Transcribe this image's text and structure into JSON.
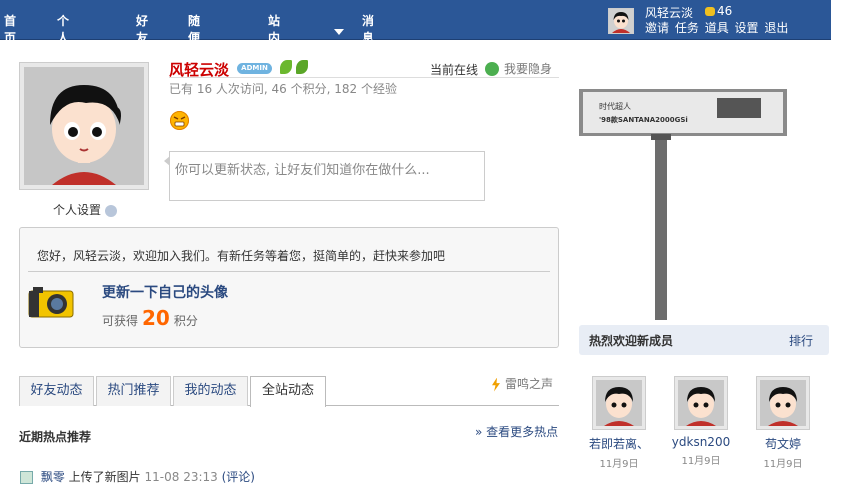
{
  "nav": {
    "items": [
      "首页",
      "个人主页",
      "好友",
      "随便看看",
      "站内导航",
      "消息"
    ]
  },
  "user_bar": {
    "name": "风轻云淡",
    "coins": "46",
    "links": [
      "邀请",
      "任务",
      "道具",
      "设置",
      "退出"
    ]
  },
  "profile": {
    "name": "风轻云淡",
    "badge": "ADMIN",
    "online": "当前在线",
    "hide": "我要隐身",
    "stats": "已有  16 人次访问, 46 个积分, 182 个经验",
    "settings": "个人设置",
    "status_placeholder": "你可以更新状态, 让好友们知道你在做什么..."
  },
  "task": {
    "welcome": "您好，风轻云淡，欢迎加入我们。有新任务等着您，挺简单的，赶快来参加吧",
    "title": "更新一下自己的头像",
    "gain_prefix": "可获得",
    "gain_value": "20",
    "gain_suffix": "积分"
  },
  "tabs": [
    {
      "label": "好友动态"
    },
    {
      "label": "热门推荐"
    },
    {
      "label": "我的动态"
    },
    {
      "label": "全站动态"
    }
  ],
  "notice": "雷鸣之声",
  "hot": {
    "title": "近期热点推荐",
    "more": "» 查看更多热点"
  },
  "feed": {
    "user": "飘零",
    "action": "上传了新图片",
    "time": "11-08 23:13",
    "comment": "(评论)"
  },
  "billboard": {
    "line1": "时代超人",
    "line2": "'98款SANTANA2000GSi"
  },
  "welcome_members": {
    "title": "热烈欢迎新成员",
    "rank": "排行",
    "members": [
      {
        "name": "若即若离、",
        "date": "11月9日"
      },
      {
        "name": "ydksn200",
        "date": "11月9日"
      },
      {
        "name": "苟文婷",
        "date": "11月9日"
      }
    ]
  },
  "colors": {
    "nav_bg": "#2b5797",
    "accent_name": "#cc0000",
    "link": "#2b4a80",
    "points": "#ff6600"
  }
}
